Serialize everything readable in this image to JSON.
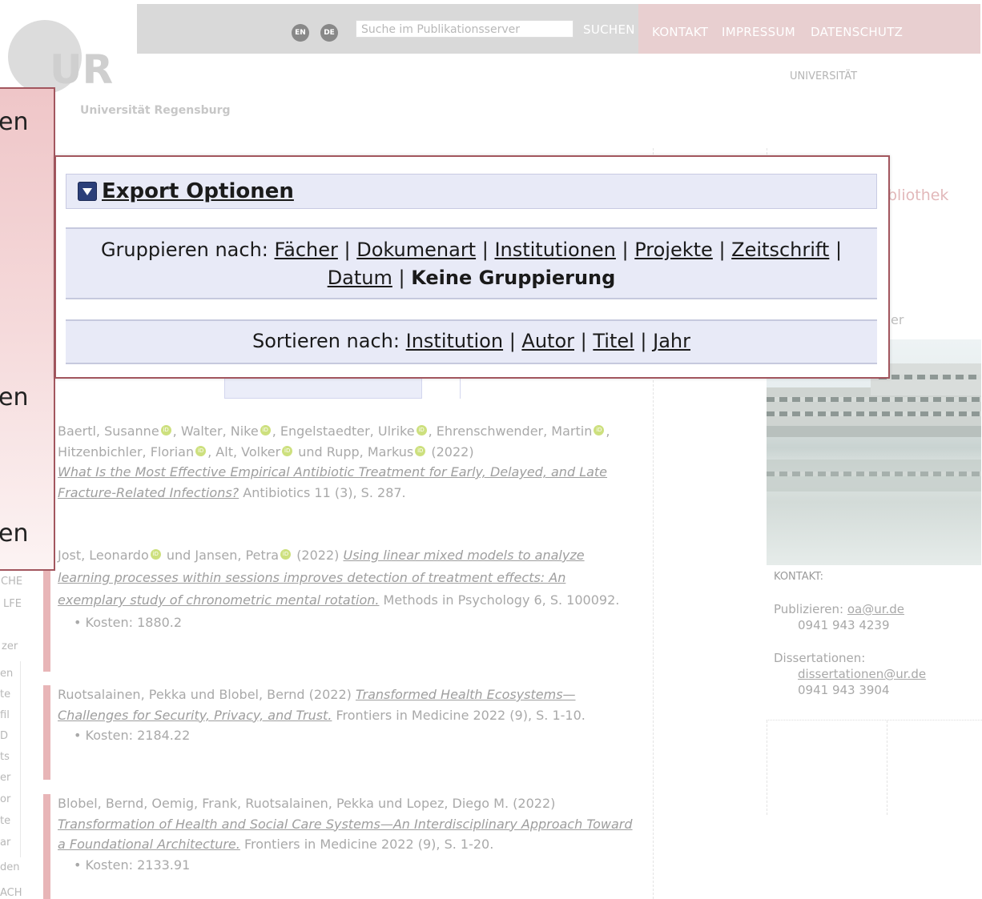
{
  "header": {
    "lang_en": "EN",
    "lang_de": "DE",
    "search_placeholder": "Suche im Publikationsserver",
    "search_button": "SUCHEN",
    "links": [
      "KONTAKT",
      "IMPRESSUM",
      "DATENSCHUTZ"
    ],
    "universitat_link": "UNIVERSITÄT"
  },
  "logo": {
    "mark": "UR",
    "subtitle": "Universität Regensburg"
  },
  "right_peek": {
    "partial_1": "bliothek",
    "partial_2": "er"
  },
  "left_overlay_fragments": [
    "en",
    "en",
    "en"
  ],
  "left_nav_fragments": [
    "CHE",
    "LFE",
    "zer",
    "en",
    "te",
    "fil",
    "D",
    "ts",
    "er",
    "or",
    "te",
    "ar",
    "den",
    "ACH"
  ],
  "export_panel": {
    "title": "Export Optionen",
    "group_label": "Gruppieren nach:",
    "group_options": [
      "Fächer",
      "Dokumenart",
      "Institutionen",
      "Projekte",
      "Zeitschrift",
      "Datum"
    ],
    "group_current": "Keine Gruppierung",
    "sort_label": "Sortieren nach:",
    "sort_options": [
      "Institution",
      "Autor",
      "Titel",
      "Jahr"
    ]
  },
  "publications": [
    {
      "authors": [
        "Baertl, Susanne",
        "Walter, Nike",
        "Engelstaedter, Ulrike",
        "Ehrenschwender, Martin",
        "Hitzenbichler, Florian",
        "Alt, Volker",
        "Rupp, Markus"
      ],
      "year": "(2022)",
      "title": "What Is the Most Effective Empirical Antibiotic Treatment for Early, Delayed, and Late Fracture-Related Infections?",
      "source": "Antibiotics 11 (3), S. 287.",
      "cost": ""
    },
    {
      "authors": [
        "Jost, Leonardo",
        "Jansen, Petra"
      ],
      "year": "(2022)",
      "title": "Using linear mixed models to analyze learning processes within sessions improves detection of treatment effects: An exemplary study of chronometric mental rotation.",
      "source": "Methods in Psychology 6, S. 100092.",
      "cost": "Kosten: 1880.2"
    },
    {
      "authors": [
        "Ruotsalainen, Pekka",
        "Blobel, Bernd"
      ],
      "year": "(2022)",
      "title": "Transformed Health Ecosystems—Challenges for Security, Privacy, and Trust.",
      "source": "Frontiers in Medicine 2022 (9), S. 1-10.",
      "cost": "Kosten: 2184.22"
    },
    {
      "authors": [
        "Blobel, Bernd",
        "Oemig, Frank",
        "Ruotsalainen, Pekka",
        "Lopez, Diego M."
      ],
      "year": "(2022)",
      "title": "Transformation of Health and Social Care Systems—An Interdisciplinary Approach Toward a Foundational Architecture.",
      "source": "Frontiers in Medicine 2022 (9), S. 1-20.",
      "cost": "Kosten: 2133.91"
    }
  ],
  "kontakt": {
    "title": "KONTAKT:",
    "publizieren_label": "Publizieren:",
    "publizieren_email": "oa@ur.de",
    "publizieren_phone": "0941 943 4239",
    "diss_label": "Dissertationen:",
    "diss_email": "dissertationen@ur.de",
    "diss_phone": "0941 943 3904"
  },
  "colors": {
    "accent_border": "#a2565e",
    "panel_bg": "#e8eaf7",
    "toggle_icon": "#2b3f79"
  }
}
